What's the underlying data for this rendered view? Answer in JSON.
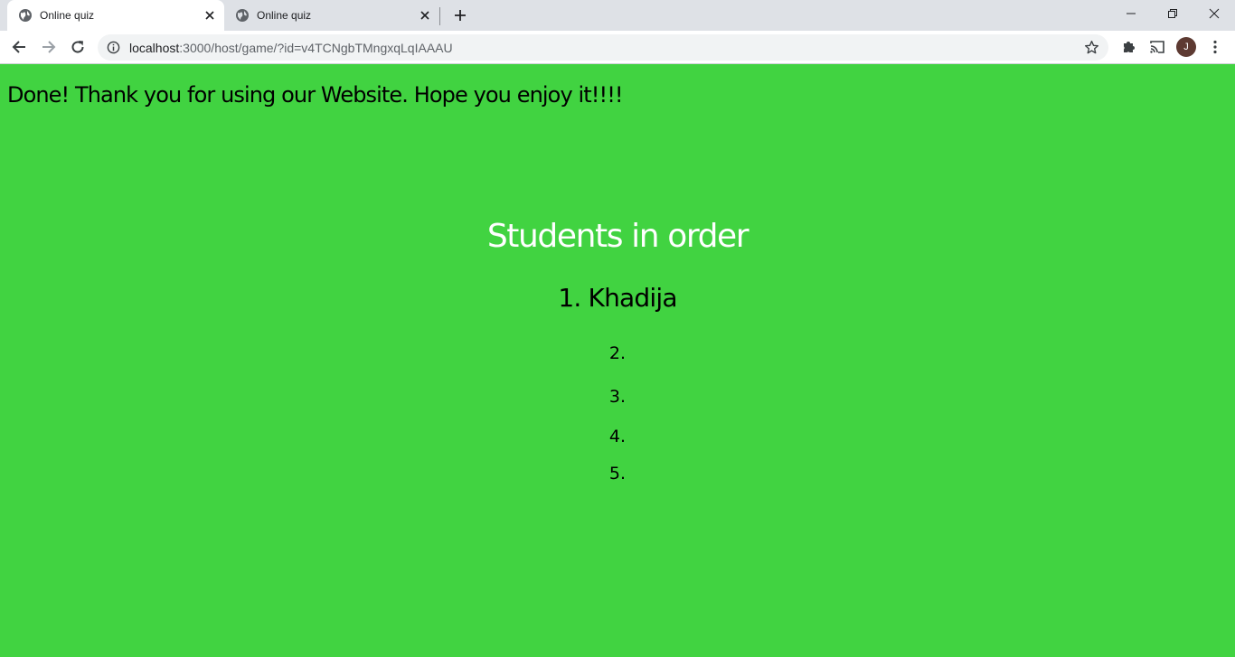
{
  "browser": {
    "tabs": [
      {
        "title": "Online quiz",
        "active": true
      },
      {
        "title": "Online quiz",
        "active": false
      }
    ],
    "url_host": "localhost",
    "url_path": ":3000/host/game/?id=v4TCNgbTMngxqLqIAAAU",
    "profile_initial": "J"
  },
  "page": {
    "background": "#41d341",
    "done_message": "Done! Thank you for using our Website. Hope you enjoy it!!!!",
    "heading": "Students in order",
    "ranks": [
      {
        "label": "1. Khadija"
      },
      {
        "label": "2."
      },
      {
        "label": "3."
      },
      {
        "label": "4."
      },
      {
        "label": "5."
      }
    ]
  }
}
